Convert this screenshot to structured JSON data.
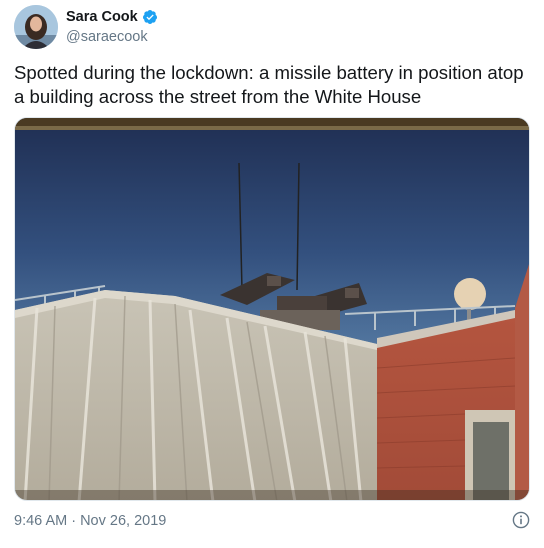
{
  "tweet": {
    "author": {
      "display_name": "Sara Cook",
      "handle": "@saraecook",
      "verified": true
    },
    "text": "Spotted during the lockdown: a missile battery in position atop a building across the street from the White House",
    "timestamp": "9:46 AM · Nov 26, 2019",
    "media_icon": "photo",
    "footer_icon": "info-icon"
  },
  "colors": {
    "text_primary": "#14171a",
    "text_secondary": "#657786",
    "verified_blue": "#1da1f2",
    "border": "#e1e8ed"
  }
}
